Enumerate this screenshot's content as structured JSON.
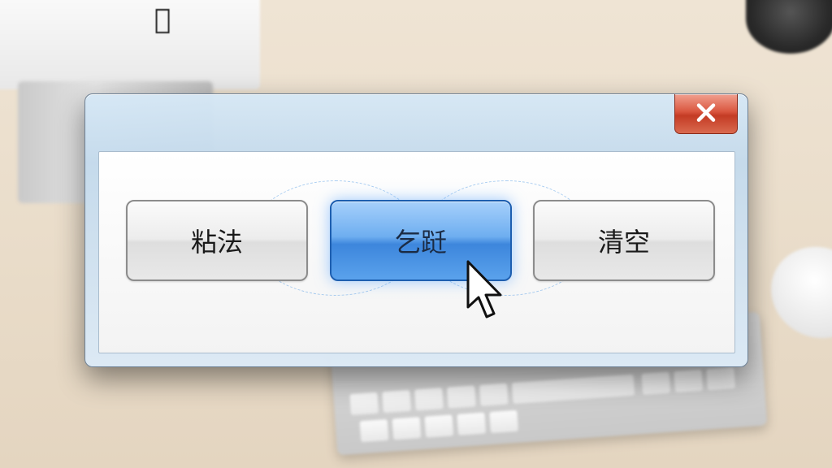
{
  "dialog": {
    "buttons": [
      {
        "label": "粘法"
      },
      {
        "label": "乞跹"
      },
      {
        "label": "清空"
      }
    ],
    "close_icon": "close-icon",
    "accent_color": "#3d86dc",
    "close_color": "#d9553e"
  },
  "cursor": {
    "icon": "mouse-pointer-icon"
  }
}
